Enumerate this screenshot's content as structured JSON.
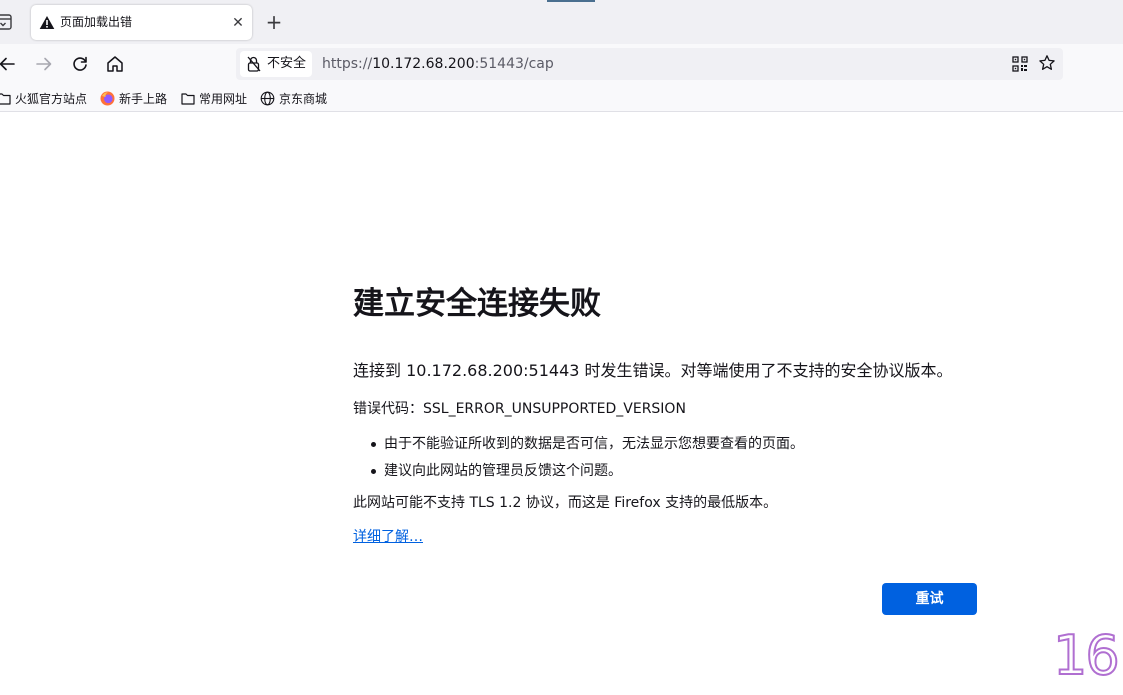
{
  "browser": {
    "tab": {
      "title": "页面加载出错",
      "close_label": "✕"
    },
    "new_tab_label": "+",
    "urlbar": {
      "security_label": "不安全",
      "url_scheme": "https://",
      "url_host": "10.172.68.200",
      "url_rest": ":51443/cap"
    },
    "bookmarks": [
      {
        "label": "火狐官方站点",
        "icon": "folder-icon"
      },
      {
        "label": "新手上路",
        "icon": "firefox-logo-icon"
      },
      {
        "label": "常用网址",
        "icon": "folder-icon"
      },
      {
        "label": "京东商城",
        "icon": "globe-icon"
      }
    ]
  },
  "error_page": {
    "title": "建立安全连接失败",
    "description": "连接到 10.172.68.200:51443 时发生错误。对等端使用了不支持的安全协议版本。",
    "error_code": "错误代码：SSL_ERROR_UNSUPPORTED_VERSION",
    "bullets": [
      "由于不能验证所收到的数据是否可信，无法显示您想要查看的页面。",
      "建议向此网站的管理员反馈这个问题。"
    ],
    "note": "此网站可能不支持 TLS 1.2 协议，而这是 Firefox 支持的最低版本。",
    "learn_more": "详细了解…",
    "retry_label": "重试"
  },
  "overlay_number": "16",
  "colors": {
    "accent": "#0061e0",
    "tabstrip": "#f0f0f4",
    "toolbar": "#f9f9fb",
    "text": "#15141a"
  }
}
